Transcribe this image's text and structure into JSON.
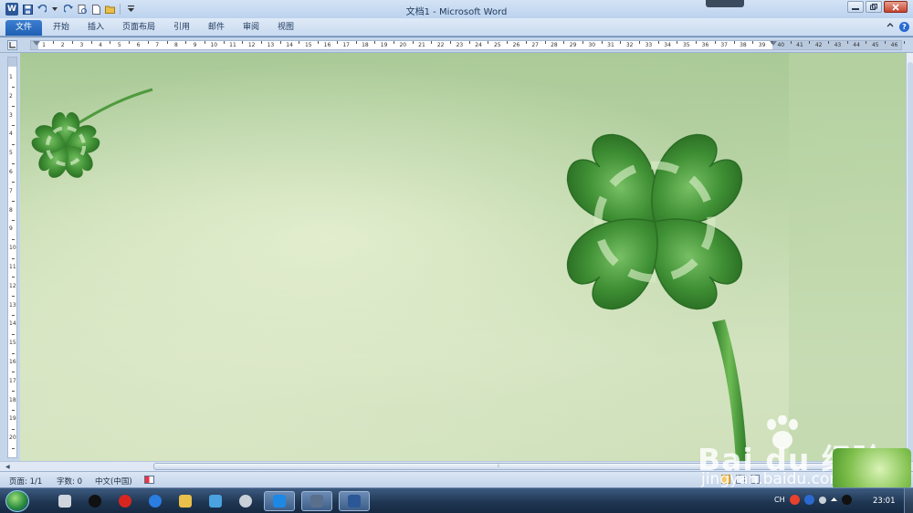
{
  "window": {
    "title": "文档1 - Microsoft Word",
    "app_icon_letter": "W"
  },
  "qat_icons": [
    "save-icon",
    "undo-icon",
    "redo-icon",
    "print-preview-icon",
    "new-document-icon",
    "open-folder-icon",
    "customize-icon"
  ],
  "ribbon": {
    "tabs": [
      "文件",
      "开始",
      "插入",
      "页面布局",
      "引用",
      "邮件",
      "审阅",
      "视图"
    ]
  },
  "ruler": {
    "horizontal_numbers": [
      "1",
      "2",
      "3",
      "4",
      "5",
      "6",
      "7",
      "8",
      "9",
      "10",
      "11",
      "12",
      "13",
      "14",
      "15",
      "16",
      "17",
      "18",
      "19",
      "20",
      "21",
      "22",
      "23",
      "24",
      "25",
      "26",
      "27",
      "28",
      "29",
      "30",
      "31",
      "32",
      "33",
      "34",
      "35",
      "36",
      "37",
      "38",
      "39",
      "40",
      "41",
      "42",
      "43",
      "44",
      "45",
      "46"
    ],
    "vertical_numbers": [
      "1",
      "2",
      "3",
      "4",
      "5",
      "6",
      "7",
      "8",
      "9",
      "10",
      "11",
      "12",
      "13",
      "14",
      "15",
      "16",
      "17",
      "18",
      "19",
      "20"
    ]
  },
  "statusbar": {
    "page": "页面: 1/1",
    "words": "字数: 0",
    "language": "中文(中国)"
  },
  "watermark": {
    "brand": "Bai  du 经验",
    "url": "jingyan.baidu.com"
  },
  "taskbar": {
    "tray_lang": "CH",
    "clock": "23:01"
  },
  "colors": {
    "clover_dark": "#2f7d2a",
    "clover_light": "#5fae4c",
    "file_tab": "#2d6fc4"
  }
}
